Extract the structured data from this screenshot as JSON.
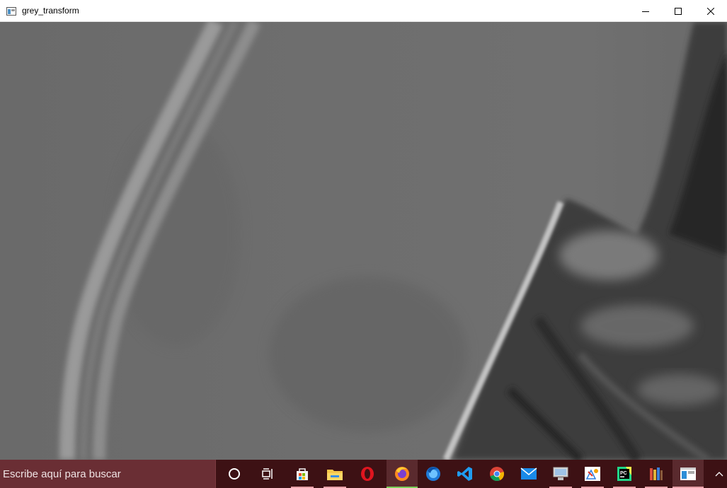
{
  "window": {
    "title": "grey_transform",
    "controls": {
      "minimize": "minimize-icon",
      "maximize": "maximize-icon",
      "close": "close-icon"
    }
  },
  "content": {
    "image": "grayscale-photo"
  },
  "taskbar": {
    "search_placeholder": "Escribe aquí para buscar",
    "items": [
      {
        "icon": "cortana-icon"
      },
      {
        "icon": "task-view-icon"
      },
      {
        "icon": "microsoft-store-icon"
      },
      {
        "icon": "file-explorer-icon"
      },
      {
        "icon": "opera-icon"
      },
      {
        "icon": "firefox-icon"
      },
      {
        "icon": "firefox-developer-icon"
      },
      {
        "icon": "vscode-icon"
      },
      {
        "icon": "chrome-icon"
      },
      {
        "icon": "mail-icon"
      },
      {
        "icon": "remote-desktop-icon"
      },
      {
        "icon": "paint-icon"
      },
      {
        "icon": "pycharm-icon"
      },
      {
        "icon": "library-books-icon"
      },
      {
        "icon": "app-window-icon"
      },
      {
        "icon": "chevron-up-icon"
      }
    ]
  },
  "colors": {
    "taskbar": "#3d1114",
    "search": "#6a2e34",
    "active_underline": "#7cc7ff"
  }
}
